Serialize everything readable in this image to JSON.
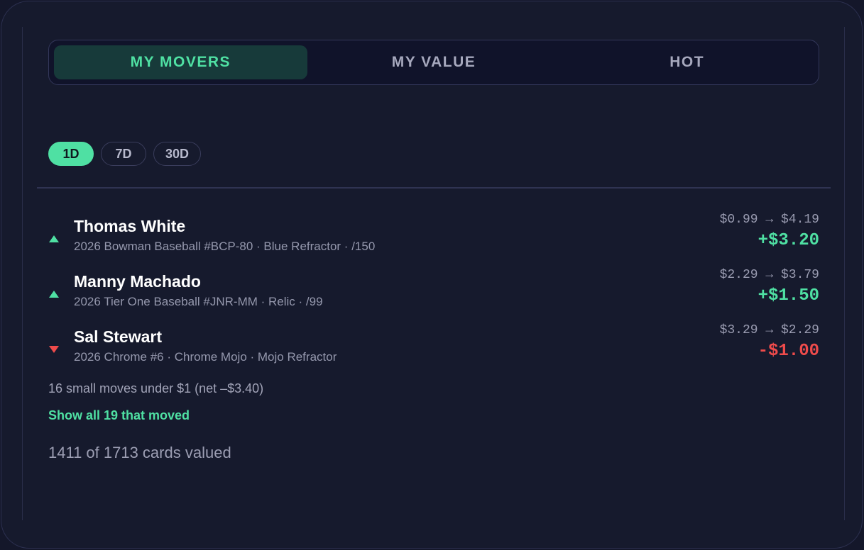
{
  "tabs": [
    {
      "label": "MY MOVERS",
      "active": true
    },
    {
      "label": "MY VALUE",
      "active": false
    },
    {
      "label": "HOT",
      "active": false
    }
  ],
  "periods": [
    {
      "label": "1D",
      "active": true
    },
    {
      "label": "7D",
      "active": false
    },
    {
      "label": "30D",
      "active": false
    }
  ],
  "movers": [
    {
      "direction": "up",
      "name": "Thomas White",
      "details": "2026 Bowman Baseball #BCP-80 · Blue Refractor · /150",
      "range": "$0.99 → $4.19",
      "delta": "+$3.20"
    },
    {
      "direction": "up",
      "name": "Manny Machado",
      "details": "2026 Tier One Baseball #JNR-MM · Relic · /99",
      "range": "$2.29 → $3.79",
      "delta": "+$1.50"
    },
    {
      "direction": "down",
      "name": "Sal Stewart",
      "details": "2026 Chrome #6 · Chrome Mojo · Mojo Refractor",
      "range": "$3.29 → $2.29",
      "delta": "-$1.00"
    }
  ],
  "summary": {
    "small_moves": "16 small moves under $1 (net –$3.40)",
    "show_all": "Show all 19 that moved",
    "valued": "1411 of 1713 cards valued"
  },
  "colors": {
    "accent": "#4fe0a3",
    "negative": "#ef4b4b",
    "background": "#161a2d"
  }
}
